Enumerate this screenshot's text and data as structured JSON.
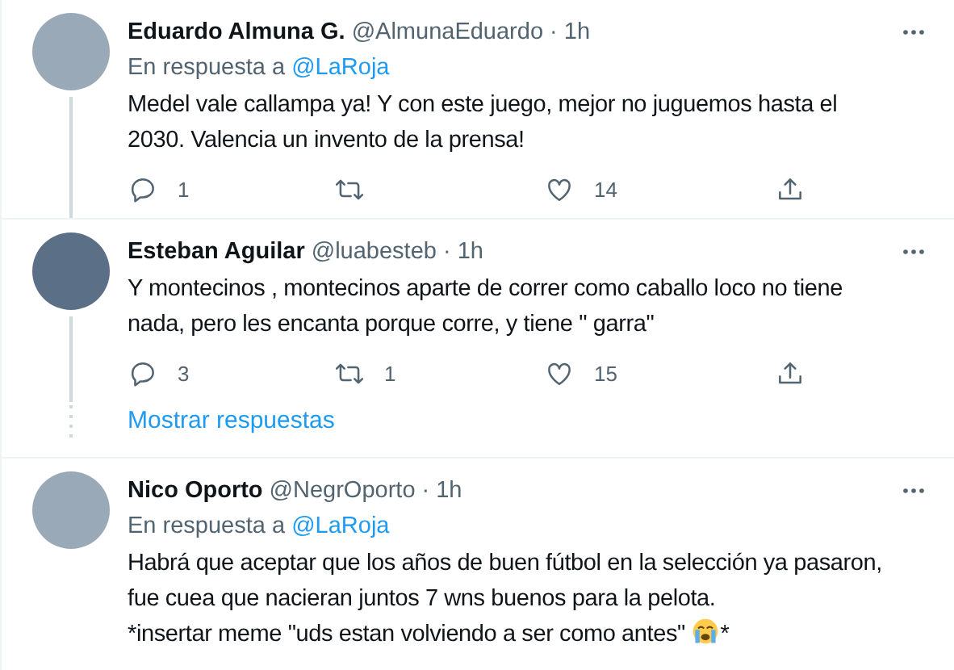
{
  "items": [
    {
      "kind": "tweet",
      "threaded": true,
      "name": "Eduardo Almuna G.",
      "handle": "@AlmunaEduardo",
      "separator": "·",
      "time": "1h",
      "reply_prefix": "En respuesta a",
      "reply_to": "@LaRoja",
      "text": "Medel vale callampa ya! Y con este juego, mejor no juguemos hasta el\n2030. Valencia un invento de la prensa!",
      "actions": {
        "replies": "1",
        "likes": "14"
      }
    },
    {
      "kind": "tweet",
      "threaded": true,
      "name": "Esteban Aguilar",
      "handle": "@luabesteb",
      "separator": "·",
      "time": "1h",
      "text": "Y montecinos , montecinos aparte de correr como caballo loco no tiene\nnada, pero les encanta porque corre, y tiene \" garra\"",
      "actions": {
        "replies": "3",
        "retweets": "1",
        "likes": "15"
      }
    },
    {
      "kind": "show_replies",
      "label": "Mostrar respuestas"
    },
    {
      "kind": "tweet",
      "threaded": false,
      "name": "Nico Oporto",
      "handle": "@NegrOporto",
      "separator": "·",
      "time": "1h",
      "reply_prefix": "En respuesta a",
      "reply_to": "@LaRoja",
      "text": "Habrá que aceptar que los años de buen fútbol en la selección ya pasaron,\nfue cuea que nacieran juntos 7 wns buenos para la pelota.\n*insertar meme \"uds estan volviendo a ser como antes\" ",
      "text_after_emoji": "*"
    }
  ]
}
